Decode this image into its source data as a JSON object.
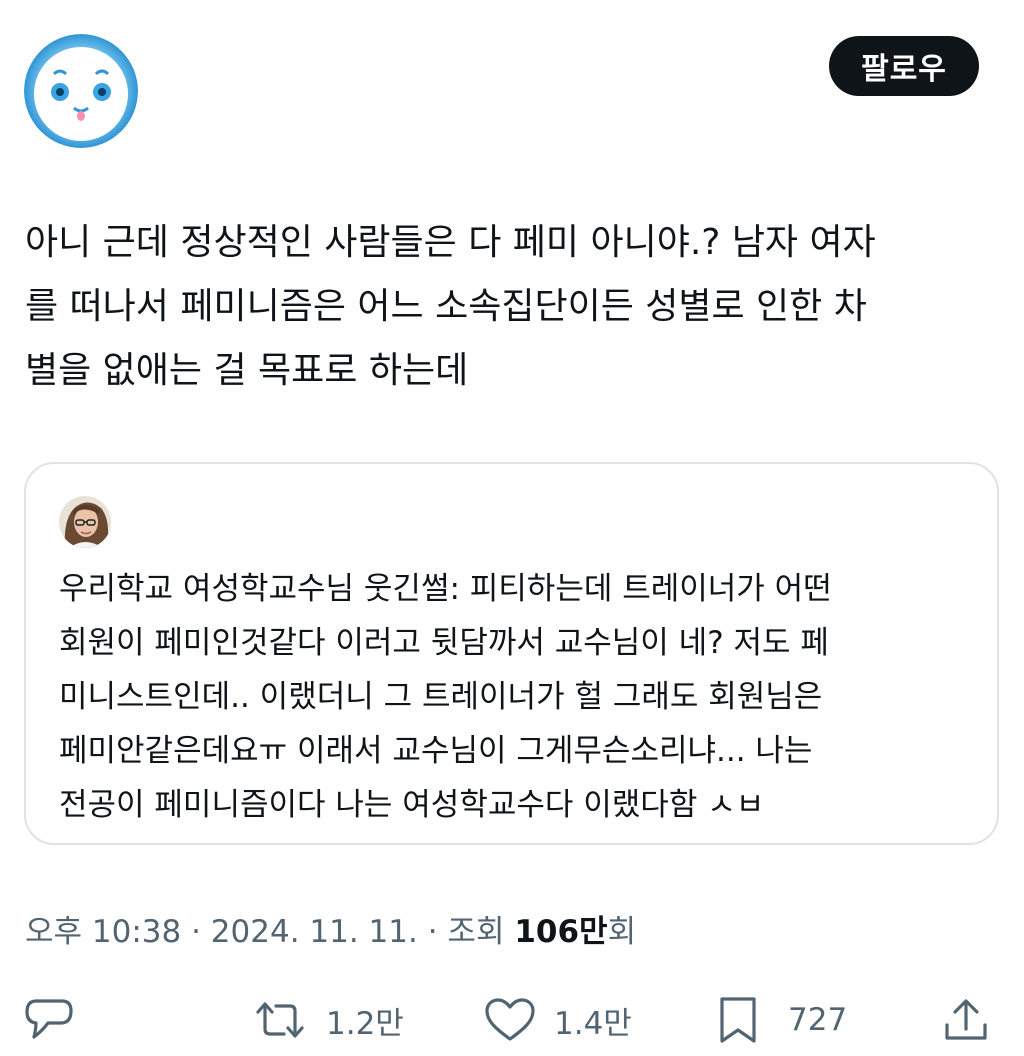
{
  "header": {
    "avatar_icon": "cartoon-face-avatar-icon",
    "follow_label": "팔로우"
  },
  "tweet": {
    "lines": [
      "아니 근데 정상적인 사람들은 다 페미 아니야.? 남자 여자",
      "를 떠나서 페미니즘은 어느 소속집단이든 성별로 인한 차",
      "별을 없애는 걸 목표로 하는데"
    ]
  },
  "quote": {
    "avatar_icon": "person-photo-avatar",
    "lines": [
      "우리학교 여성학교수님 웃긴썰: 피티하는데 트레이너가 어떤",
      "회원이 페미인것같다 이러고 뒷담까서 교수님이 네? 저도 페",
      "미니스트인데.. 이랬더니 그 트레이너가 헐 그래도 회원님은",
      "페미안같은데요ㅠ 이래서 교수님이 그게무슨소리냐... 나는",
      "전공이 페미니즘이다 나는 여성학교수다 이랬다함 ㅅㅂ"
    ]
  },
  "meta": {
    "time": "오후 10:38",
    "sep1": " · ",
    "date": "2024. 11. 11.",
    "sep2": " · ",
    "views_label": "조회 ",
    "views_num": "106",
    "views_unit": "만",
    "views_suffix": "회"
  },
  "actions": {
    "reply": {
      "icon": "reply-bubble-icon"
    },
    "retweet": {
      "icon": "retweet-icon",
      "count": "1.2만"
    },
    "like": {
      "icon": "heart-icon",
      "count": "1.4만"
    },
    "bookmark": {
      "icon": "bookmark-icon",
      "count": "727"
    },
    "share": {
      "icon": "share-upload-icon"
    }
  },
  "colors": {
    "text": "#0f1419",
    "secondary": "#536471",
    "border": "#dfe3e7",
    "avatar_blue": "#3aa3e0"
  }
}
